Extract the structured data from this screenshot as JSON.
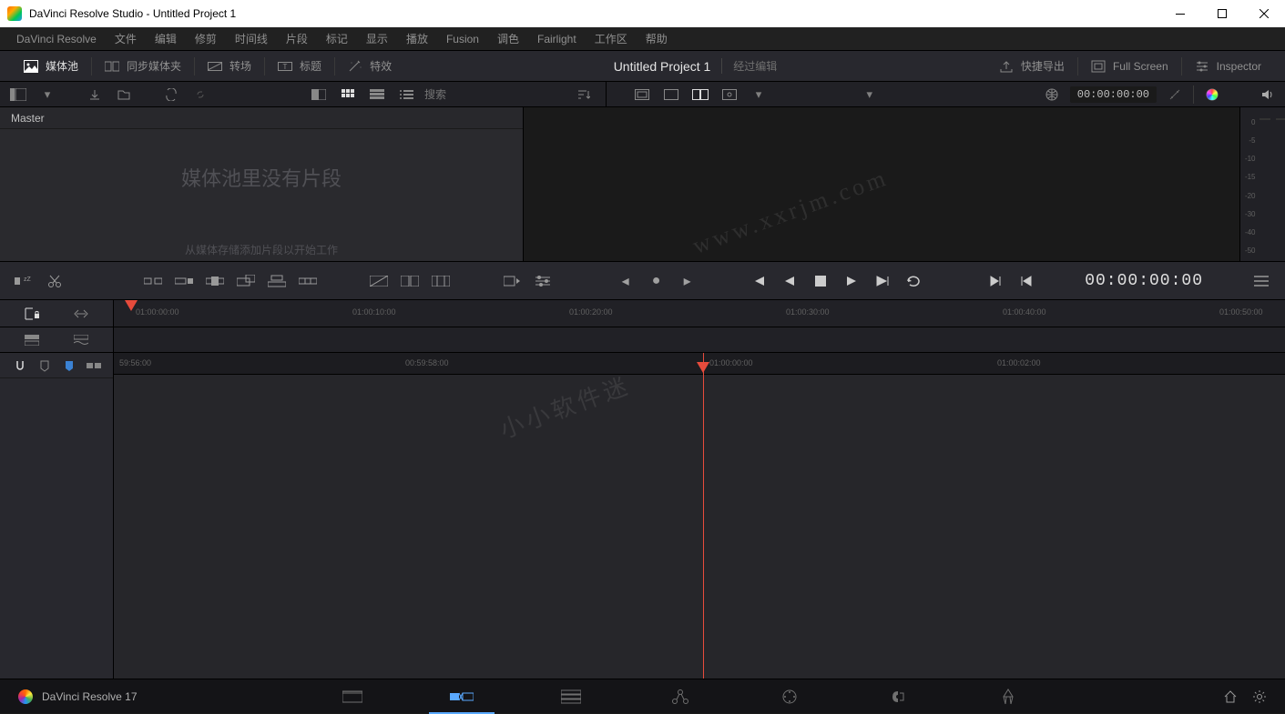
{
  "window": {
    "title": "DaVinci Resolve Studio - Untitled Project 1"
  },
  "menu": [
    "DaVinci Resolve",
    "文件",
    "编辑",
    "修剪",
    "时间线",
    "片段",
    "标记",
    "显示",
    "播放",
    "Fusion",
    "调色",
    "Fairlight",
    "工作区",
    "帮助"
  ],
  "tabs": {
    "media_pool": "媒体池",
    "sync_bin": "同步媒体夹",
    "transitions": "转场",
    "titles": "标题",
    "effects": "特效",
    "quick_export": "快捷导出",
    "full_screen": "Full Screen",
    "inspector": "Inspector"
  },
  "project": {
    "title": "Untitled Project 1",
    "status": "经过编辑"
  },
  "search": {
    "placeholder": "搜索"
  },
  "viewer_tc": "00:00:00:00",
  "pool": {
    "master": "Master",
    "empty_big": "媒体池里没有片段",
    "empty_small": "从媒体存储添加片段以开始工作"
  },
  "meter_labels": [
    "0",
    "-5",
    "-10",
    "-15",
    "-20",
    "-30",
    "-40",
    "-50"
  ],
  "transport_tc": "00:00:00:00",
  "ruler1": [
    "01:00:00:00",
    "01:00:10:00",
    "01:00:20:00",
    "01:00:30:00",
    "01:00:40:00",
    "01:00:50:00"
  ],
  "ruler2": [
    "59:56:00",
    "00:59:58:00",
    "01:00:00:00",
    "01:00:02:00"
  ],
  "brand": "DaVinci Resolve 17",
  "watermark1": "小小软件迷",
  "watermark2": "www.xxrjm.com"
}
